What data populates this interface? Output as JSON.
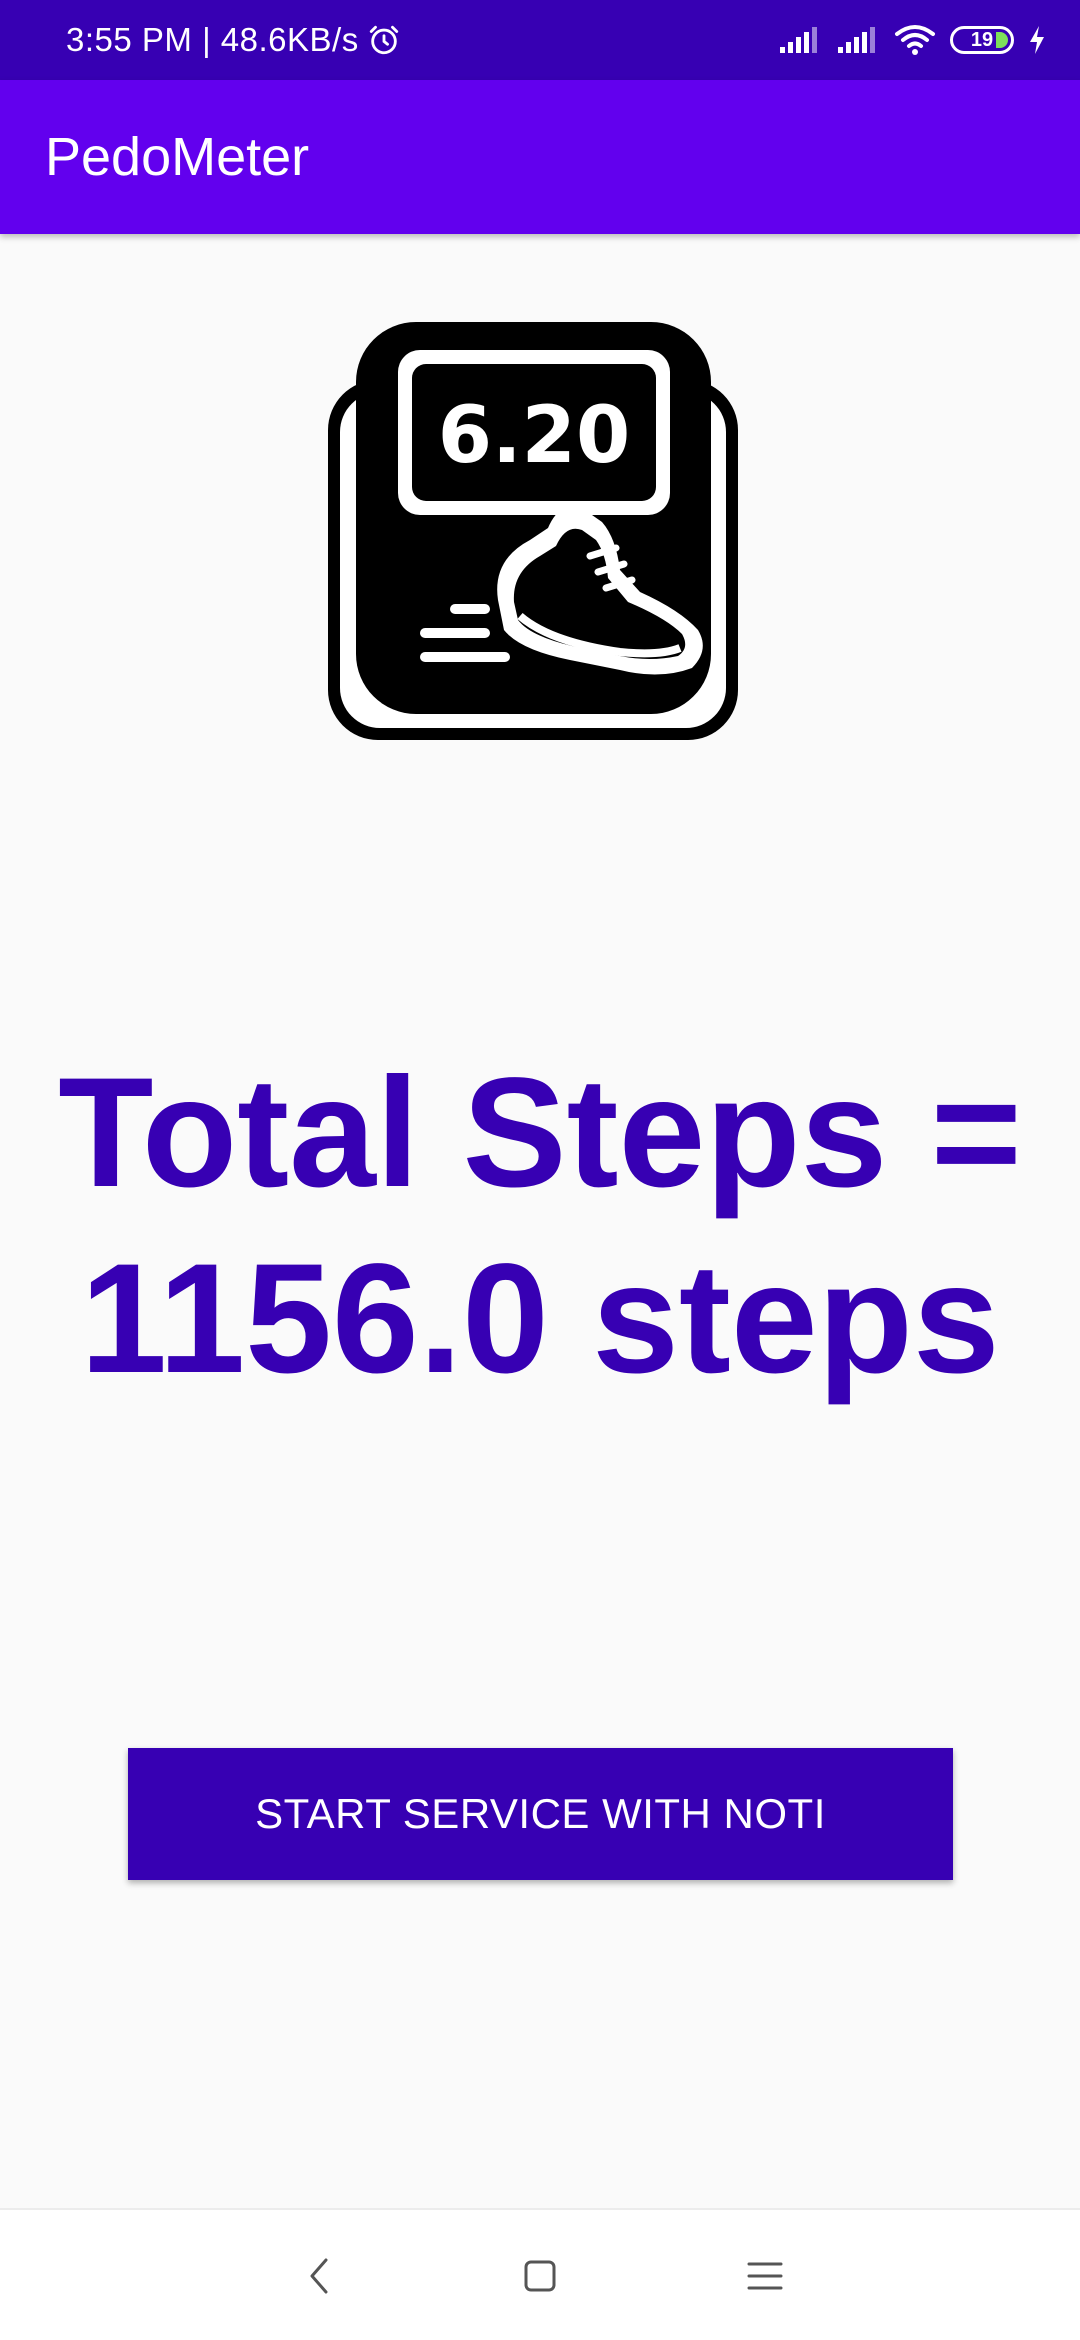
{
  "status_bar": {
    "time_speed": "3:55 PM | 48.6KB/s",
    "battery_level": "19",
    "icons": [
      "alarm-icon",
      "signal-icon",
      "signal-icon",
      "wifi-icon",
      "battery-icon",
      "charging-icon"
    ]
  },
  "app_bar": {
    "title": "PedoMeter"
  },
  "illustration": {
    "display_value": "6.20",
    "icon": "pedometer-shoe-icon"
  },
  "main": {
    "total_steps_text": "Total Steps = 1156.0 steps"
  },
  "actions": {
    "start_button_label": "START SERVICE WITH NOTI"
  },
  "nav_bar": {
    "icons": [
      "back-icon",
      "home-icon",
      "recents-icon"
    ]
  },
  "colors": {
    "status_bar": "#3700b3",
    "app_bar": "#6200ee",
    "accent_text": "#3700b3",
    "button": "#3700b3",
    "background": "#fafafa"
  }
}
